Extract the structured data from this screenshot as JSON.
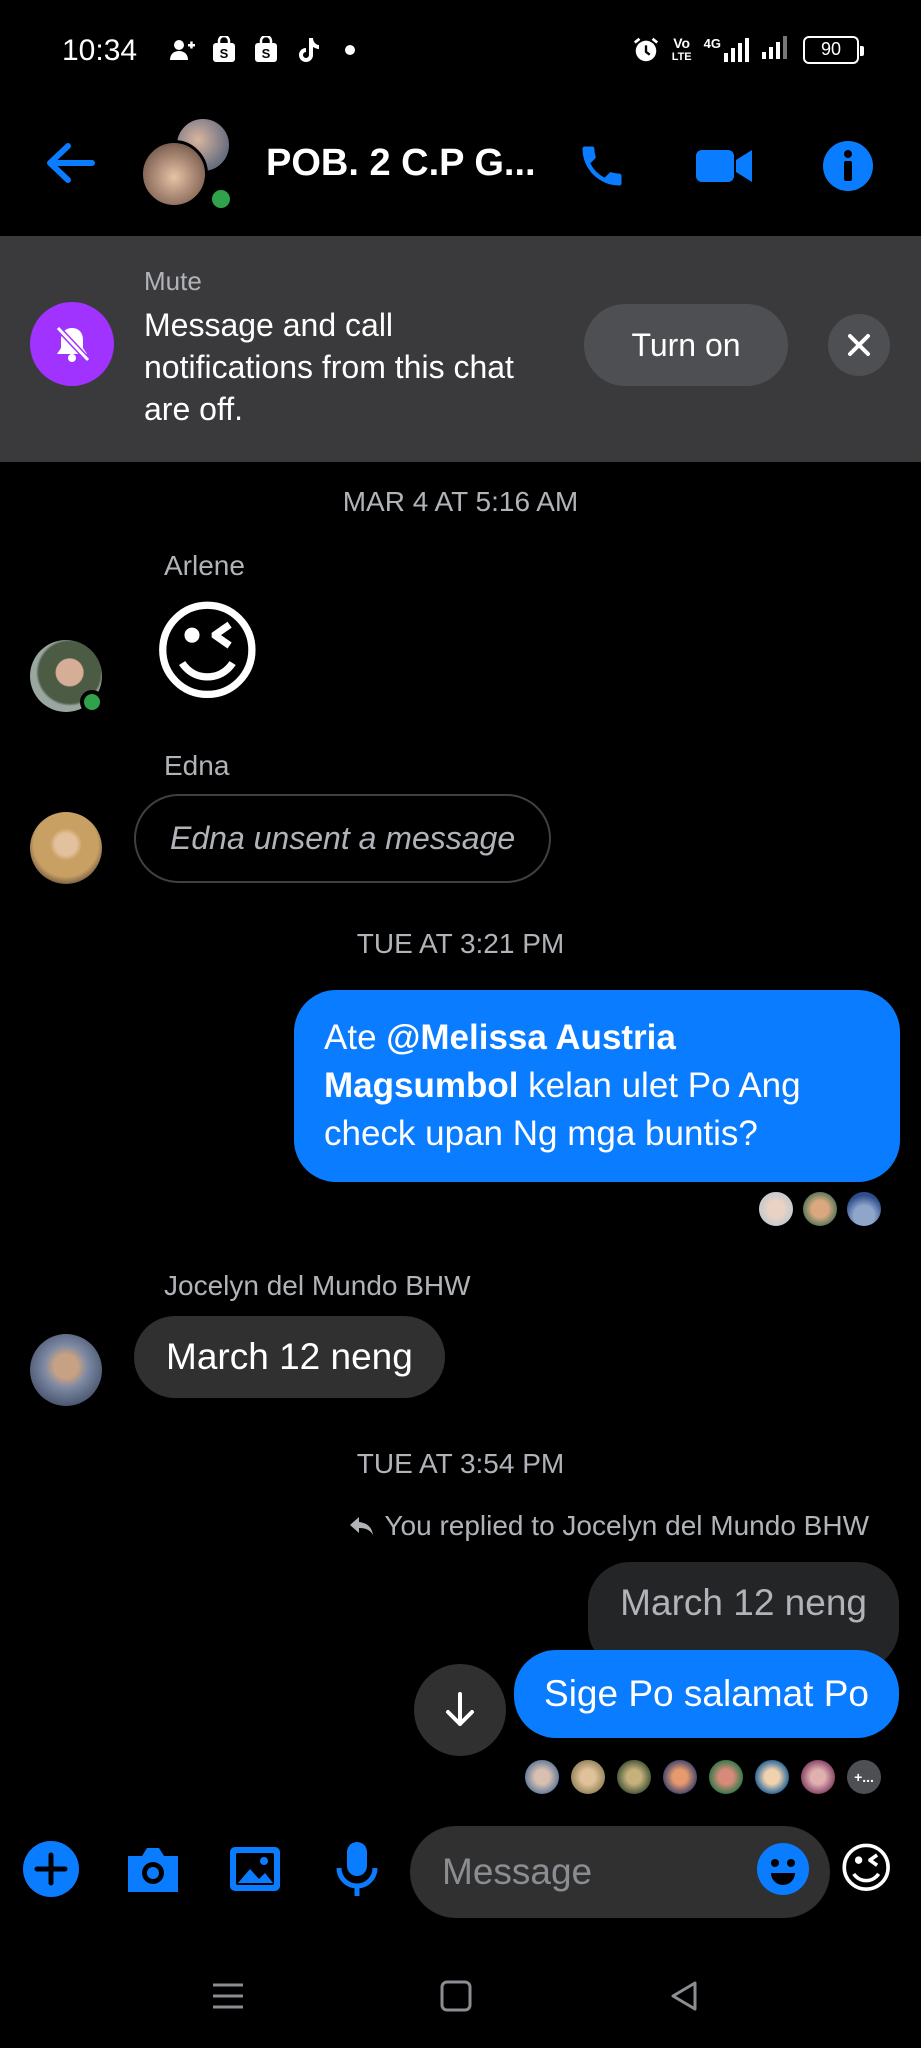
{
  "status_bar": {
    "time": "10:34",
    "net_top": "Vo",
    "net_bottom": "LTE",
    "net_type": "4G",
    "battery": "90",
    "left_icons": [
      "add-user-icon",
      "shop-icon",
      "shop-icon",
      "tiktok-icon",
      "dot-icon"
    ],
    "right_icons": [
      "alarm-icon",
      "volte-icon",
      "signal-icon",
      "signal-icon",
      "battery-icon"
    ]
  },
  "header": {
    "title": "POB. 2 C.P G...",
    "icons": [
      "back-arrow-icon",
      "phone-icon",
      "video-icon",
      "info-icon"
    ],
    "accent": "#0a7cff"
  },
  "mute_banner": {
    "label": "Mute",
    "text": "Message and call notifications from this chat are off.",
    "button": "Turn on",
    "icon_color": "#a033ff"
  },
  "messages": {
    "ts1": "MAR 4 AT 5:16 AM",
    "arlene": {
      "sender": "Arlene",
      "emoji": "😉"
    },
    "edna": {
      "sender": "Edna",
      "text": "Edna unsent a message"
    },
    "ts2": "TUE AT 3:21 PM",
    "outgoing1": {
      "prefix": "Ate ",
      "mention": "@Melissa Austria Magsumbol",
      "rest": " kelan ulet Po Ang check upan Ng mga buntis?"
    },
    "jocelyn": {
      "sender": "Jocelyn del Mundo BHW",
      "text": "March 12 neng"
    },
    "ts3": "TUE AT 3:54 PM",
    "reply_note": "You replied to Jocelyn del Mundo BHW",
    "quoted": "March 12 neng",
    "outgoing2": "Sige Po salamat Po",
    "seen_more": "+..."
  },
  "composer": {
    "placeholder": "Message",
    "icons": [
      "plus-icon",
      "camera-icon",
      "gallery-icon",
      "mic-icon",
      "emoji-icon",
      "wink-emoji-icon"
    ],
    "quick_emoji": "😉"
  },
  "navbar": {
    "icons": [
      "menu-icon",
      "home-square-icon",
      "back-triangle-icon"
    ]
  }
}
